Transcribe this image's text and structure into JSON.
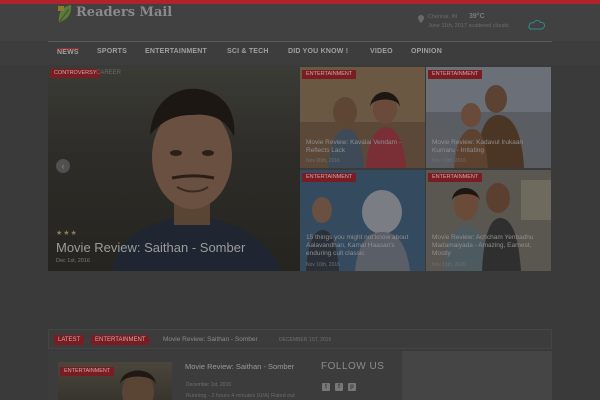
{
  "site": {
    "name": "Readers Mail"
  },
  "weather": {
    "city": "Chennai, IN",
    "temp": "39°C",
    "date_line": "June 11th, 2017 scattered clouds",
    "icon": "cloud-icon"
  },
  "nav": {
    "items": [
      {
        "label": "NEWS",
        "active": true
      },
      {
        "label": "SPORTS"
      },
      {
        "label": "ENTERTAINMENT"
      },
      {
        "label": "SCI & TECH"
      },
      {
        "label": "DID YOU KNOW !"
      },
      {
        "label": "VIDEO"
      },
      {
        "label": "OPINION"
      }
    ]
  },
  "slider": {
    "category": "CONTROVERSY",
    "category2": "CAREER",
    "rating_stars": "★★★",
    "rating": 3,
    "rating_max": 5,
    "title": "Movie Review: Saithan - Somber",
    "date": "Dec 1st, 2016",
    "prev_icon": "chevron-left-icon"
  },
  "tiles": [
    {
      "category": "ENTERTAINMENT",
      "title": "Movie Review: Kavalai Vendam - Reflects Lack",
      "date": "Nov 26th, 2016"
    },
    {
      "category": "ENTERTAINMENT",
      "title": "Movie Review: Kadavul Irukaan Kumaru - Irritating",
      "date": "Nov 19th, 2016"
    },
    {
      "category": "ENTERTAINMENT",
      "title": "15 things you might not know about Aalavandhan, Kamal Haasan's enduring cult classic",
      "date": "Nov 16th, 2016"
    },
    {
      "category": "ENTERTAINMENT",
      "title": "Movie Review: Achcham Yenbadhu Madamaiyada - Amazing, Earnest, Mostly",
      "date": "Nov 11th, 2016"
    }
  ],
  "ticker": {
    "badge_latest": "LATEST",
    "badge_category": "ENTERTAINMENT",
    "title": "Movie Review: Saithan - Somber",
    "date": "DECEMBER 1ST, 2016"
  },
  "post": {
    "category": "ENTERTAINMENT",
    "title": "Movie Review: Saithan - Somber",
    "date": "December 1st, 2016",
    "excerpt": "Running - 2 hours 4 minutes (U/A) Rated out"
  },
  "follow": {
    "title": "FOLLOW US",
    "icons": [
      "twitter-icon",
      "facebook-icon",
      "pinterest-icon"
    ]
  },
  "colors": {
    "accent": "#b1232c",
    "overlay_bg": "#3f3f3f"
  }
}
